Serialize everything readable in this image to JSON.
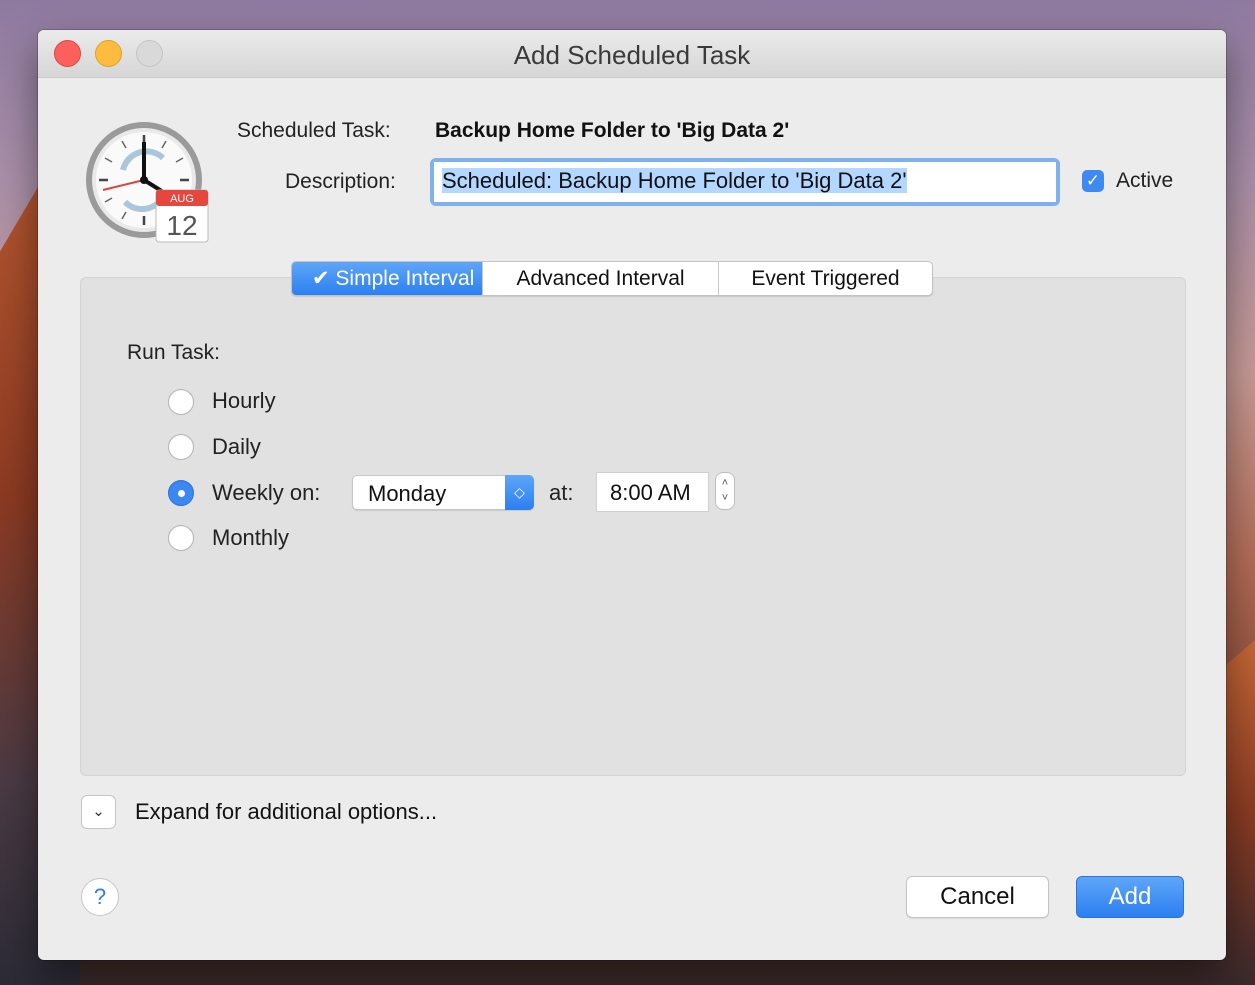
{
  "window": {
    "title": "Add Scheduled Task"
  },
  "header": {
    "task_label": "Scheduled Task:",
    "task_name": "Backup Home Folder to 'Big Data 2'",
    "description_label": "Description:",
    "description_value": "Scheduled: Backup Home Folder to 'Big Data 2'",
    "active_label": "Active",
    "active_checked": true,
    "icon_calendar_month": "AUG",
    "icon_calendar_day": "12"
  },
  "tabs": [
    {
      "label": "✔ Simple Interval",
      "selected": true
    },
    {
      "label": "Advanced Interval",
      "selected": false
    },
    {
      "label": "Event Triggered",
      "selected": false
    }
  ],
  "schedule": {
    "run_task_label": "Run Task:",
    "options": [
      {
        "label": "Hourly",
        "selected": false
      },
      {
        "label": "Daily",
        "selected": false
      },
      {
        "label": "Weekly on:",
        "selected": true
      },
      {
        "label": "Monthly",
        "selected": false
      }
    ],
    "weekday_value": "Monday",
    "at_label": "at:",
    "time_value": "8:00 AM"
  },
  "footer": {
    "expand_label": "Expand for additional options...",
    "help_label": "?",
    "cancel_label": "Cancel",
    "add_label": "Add"
  },
  "colors": {
    "accent": "#2d7ff1",
    "window_bg": "#ececec",
    "panel_bg": "#e1e1e1"
  }
}
